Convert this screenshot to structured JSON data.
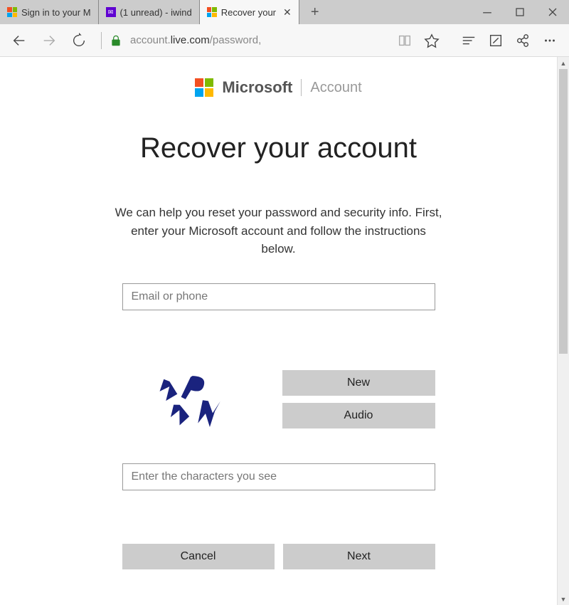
{
  "tabs": [
    {
      "title": "Sign in to your M"
    },
    {
      "title": "(1 unread) - iwind"
    },
    {
      "title": "Recover your"
    }
  ],
  "address": {
    "host_prefix": "account.",
    "host_bold": "live.com",
    "path": "/password,"
  },
  "brand": {
    "company": "Microsoft",
    "section": "Account"
  },
  "page": {
    "title": "Recover your account",
    "instructions": "We can help you reset your password and security info. First, enter your Microsoft account and follow the instructions below.",
    "email_placeholder": "Email or phone",
    "captcha_placeholder": "Enter the characters you see",
    "captcha_text": "VPNY"
  },
  "buttons": {
    "new": "New",
    "audio": "Audio",
    "cancel": "Cancel",
    "next": "Next"
  }
}
